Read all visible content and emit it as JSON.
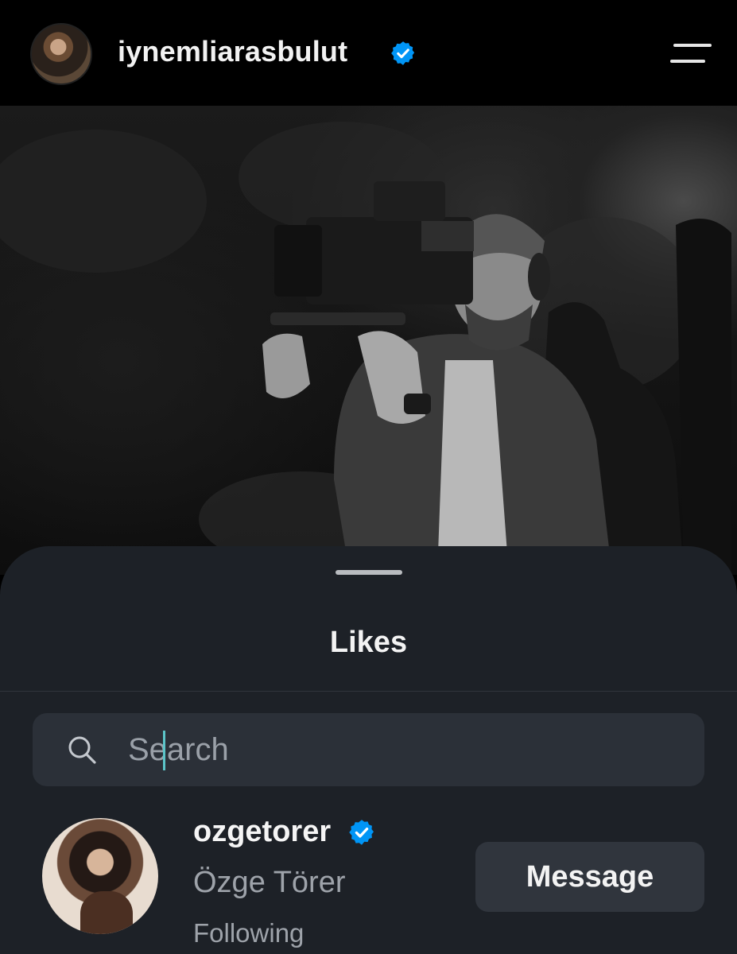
{
  "header": {
    "username": "iynemliarasbulut",
    "verified": true,
    "avatar_icon": "profile-avatar",
    "menu_icon": "menu-icon"
  },
  "post": {
    "image_icon": "post-photo"
  },
  "likes_sheet": {
    "title": "Likes",
    "search": {
      "placeholder": "Search",
      "value": ""
    },
    "users": [
      {
        "username": "ozgetorer",
        "verified": true,
        "full_name": "Özge Törer",
        "status": "Following",
        "action_label": "Message"
      }
    ]
  },
  "colors": {
    "background": "#000000",
    "sheet": "#1d2127",
    "search_bg": "#2b3038",
    "button_bg": "#30353d",
    "verified_blue": "#0095f6",
    "secondary_text": "#9ea3aa",
    "caret": "#5cc5c9"
  }
}
